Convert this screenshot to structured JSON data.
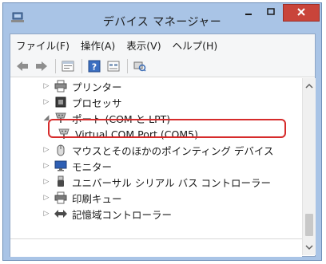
{
  "window": {
    "title": "デバイス マネージャー"
  },
  "menubar": {
    "items": [
      "ファイル(F)",
      "操作(A)",
      "表示(V)",
      "ヘルプ(H)"
    ]
  },
  "toolbar": {
    "buttons": [
      "back-icon",
      "forward-icon",
      "properties-icon",
      "help-icon",
      "view-icon",
      "scan-hardware-icon"
    ]
  },
  "tree": {
    "rows": [
      {
        "label": "プリンター",
        "icon": "printer-icon",
        "expander": "▷"
      },
      {
        "label": "プロセッサ",
        "icon": "processor-icon",
        "expander": "▷"
      },
      {
        "label": "ポート (COM と LPT)",
        "icon": "port-icon",
        "expander": "◢"
      },
      {
        "label": "Virtual COM Port (COM5)",
        "icon": "port-device-icon",
        "expander": ""
      },
      {
        "label": "マウスとそのほかのポインティング デバイス",
        "icon": "mouse-icon",
        "expander": "▷"
      },
      {
        "label": "モニター",
        "icon": "monitor-icon",
        "expander": "▷"
      },
      {
        "label": "ユニバーサル シリアル バス コントローラー",
        "icon": "usb-icon",
        "expander": "▷"
      },
      {
        "label": "印刷キュー",
        "icon": "print-queue-icon",
        "expander": "▷"
      },
      {
        "label": "記憶域コントローラー",
        "icon": "storage-controller-icon",
        "expander": "▷"
      }
    ]
  },
  "colors": {
    "highlight": "#d62b2b",
    "close_button": "#c9443a",
    "frame": "#a9c4e6"
  }
}
